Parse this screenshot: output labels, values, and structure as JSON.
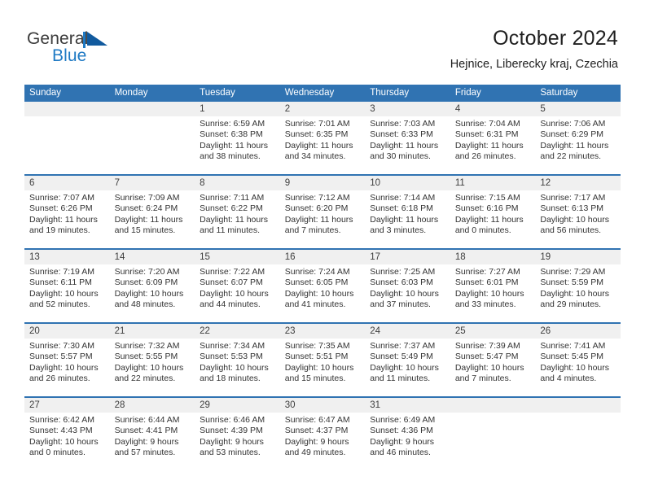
{
  "logo": {
    "word_one": "General",
    "word_two": "Blue",
    "triangle_icon": "blue-flag-triangle-icon",
    "brand_blue": "#1f7ac4"
  },
  "header": {
    "title": "October 2024",
    "subtitle": "Hejnice, Liberecky kraj, Czechia"
  },
  "theme": {
    "header_blue": "#3073b2",
    "daynum_gray": "#f0f0f0"
  },
  "calendar": {
    "weekday_headers": [
      "Sunday",
      "Monday",
      "Tuesday",
      "Wednesday",
      "Thursday",
      "Friday",
      "Saturday"
    ],
    "weeks": [
      {
        "days": [
          {
            "num": "",
            "lines": []
          },
          {
            "num": "",
            "lines": []
          },
          {
            "num": "1",
            "lines": [
              "Sunrise: 6:59 AM",
              "Sunset: 6:38 PM",
              "Daylight: 11 hours",
              "and 38 minutes."
            ]
          },
          {
            "num": "2",
            "lines": [
              "Sunrise: 7:01 AM",
              "Sunset: 6:35 PM",
              "Daylight: 11 hours",
              "and 34 minutes."
            ]
          },
          {
            "num": "3",
            "lines": [
              "Sunrise: 7:03 AM",
              "Sunset: 6:33 PM",
              "Daylight: 11 hours",
              "and 30 minutes."
            ]
          },
          {
            "num": "4",
            "lines": [
              "Sunrise: 7:04 AM",
              "Sunset: 6:31 PM",
              "Daylight: 11 hours",
              "and 26 minutes."
            ]
          },
          {
            "num": "5",
            "lines": [
              "Sunrise: 7:06 AM",
              "Sunset: 6:29 PM",
              "Daylight: 11 hours",
              "and 22 minutes."
            ]
          }
        ]
      },
      {
        "days": [
          {
            "num": "6",
            "lines": [
              "Sunrise: 7:07 AM",
              "Sunset: 6:26 PM",
              "Daylight: 11 hours",
              "and 19 minutes."
            ]
          },
          {
            "num": "7",
            "lines": [
              "Sunrise: 7:09 AM",
              "Sunset: 6:24 PM",
              "Daylight: 11 hours",
              "and 15 minutes."
            ]
          },
          {
            "num": "8",
            "lines": [
              "Sunrise: 7:11 AM",
              "Sunset: 6:22 PM",
              "Daylight: 11 hours",
              "and 11 minutes."
            ]
          },
          {
            "num": "9",
            "lines": [
              "Sunrise: 7:12 AM",
              "Sunset: 6:20 PM",
              "Daylight: 11 hours",
              "and 7 minutes."
            ]
          },
          {
            "num": "10",
            "lines": [
              "Sunrise: 7:14 AM",
              "Sunset: 6:18 PM",
              "Daylight: 11 hours",
              "and 3 minutes."
            ]
          },
          {
            "num": "11",
            "lines": [
              "Sunrise: 7:15 AM",
              "Sunset: 6:16 PM",
              "Daylight: 11 hours",
              "and 0 minutes."
            ]
          },
          {
            "num": "12",
            "lines": [
              "Sunrise: 7:17 AM",
              "Sunset: 6:13 PM",
              "Daylight: 10 hours",
              "and 56 minutes."
            ]
          }
        ]
      },
      {
        "days": [
          {
            "num": "13",
            "lines": [
              "Sunrise: 7:19 AM",
              "Sunset: 6:11 PM",
              "Daylight: 10 hours",
              "and 52 minutes."
            ]
          },
          {
            "num": "14",
            "lines": [
              "Sunrise: 7:20 AM",
              "Sunset: 6:09 PM",
              "Daylight: 10 hours",
              "and 48 minutes."
            ]
          },
          {
            "num": "15",
            "lines": [
              "Sunrise: 7:22 AM",
              "Sunset: 6:07 PM",
              "Daylight: 10 hours",
              "and 44 minutes."
            ]
          },
          {
            "num": "16",
            "lines": [
              "Sunrise: 7:24 AM",
              "Sunset: 6:05 PM",
              "Daylight: 10 hours",
              "and 41 minutes."
            ]
          },
          {
            "num": "17",
            "lines": [
              "Sunrise: 7:25 AM",
              "Sunset: 6:03 PM",
              "Daylight: 10 hours",
              "and 37 minutes."
            ]
          },
          {
            "num": "18",
            "lines": [
              "Sunrise: 7:27 AM",
              "Sunset: 6:01 PM",
              "Daylight: 10 hours",
              "and 33 minutes."
            ]
          },
          {
            "num": "19",
            "lines": [
              "Sunrise: 7:29 AM",
              "Sunset: 5:59 PM",
              "Daylight: 10 hours",
              "and 29 minutes."
            ]
          }
        ]
      },
      {
        "days": [
          {
            "num": "20",
            "lines": [
              "Sunrise: 7:30 AM",
              "Sunset: 5:57 PM",
              "Daylight: 10 hours",
              "and 26 minutes."
            ]
          },
          {
            "num": "21",
            "lines": [
              "Sunrise: 7:32 AM",
              "Sunset: 5:55 PM",
              "Daylight: 10 hours",
              "and 22 minutes."
            ]
          },
          {
            "num": "22",
            "lines": [
              "Sunrise: 7:34 AM",
              "Sunset: 5:53 PM",
              "Daylight: 10 hours",
              "and 18 minutes."
            ]
          },
          {
            "num": "23",
            "lines": [
              "Sunrise: 7:35 AM",
              "Sunset: 5:51 PM",
              "Daylight: 10 hours",
              "and 15 minutes."
            ]
          },
          {
            "num": "24",
            "lines": [
              "Sunrise: 7:37 AM",
              "Sunset: 5:49 PM",
              "Daylight: 10 hours",
              "and 11 minutes."
            ]
          },
          {
            "num": "25",
            "lines": [
              "Sunrise: 7:39 AM",
              "Sunset: 5:47 PM",
              "Daylight: 10 hours",
              "and 7 minutes."
            ]
          },
          {
            "num": "26",
            "lines": [
              "Sunrise: 7:41 AM",
              "Sunset: 5:45 PM",
              "Daylight: 10 hours",
              "and 4 minutes."
            ]
          }
        ]
      },
      {
        "days": [
          {
            "num": "27",
            "lines": [
              "Sunrise: 6:42 AM",
              "Sunset: 4:43 PM",
              "Daylight: 10 hours",
              "and 0 minutes."
            ]
          },
          {
            "num": "28",
            "lines": [
              "Sunrise: 6:44 AM",
              "Sunset: 4:41 PM",
              "Daylight: 9 hours",
              "and 57 minutes."
            ]
          },
          {
            "num": "29",
            "lines": [
              "Sunrise: 6:46 AM",
              "Sunset: 4:39 PM",
              "Daylight: 9 hours",
              "and 53 minutes."
            ]
          },
          {
            "num": "30",
            "lines": [
              "Sunrise: 6:47 AM",
              "Sunset: 4:37 PM",
              "Daylight: 9 hours",
              "and 49 minutes."
            ]
          },
          {
            "num": "31",
            "lines": [
              "Sunrise: 6:49 AM",
              "Sunset: 4:36 PM",
              "Daylight: 9 hours",
              "and 46 minutes."
            ]
          },
          {
            "num": "",
            "lines": []
          },
          {
            "num": "",
            "lines": []
          }
        ]
      }
    ]
  }
}
